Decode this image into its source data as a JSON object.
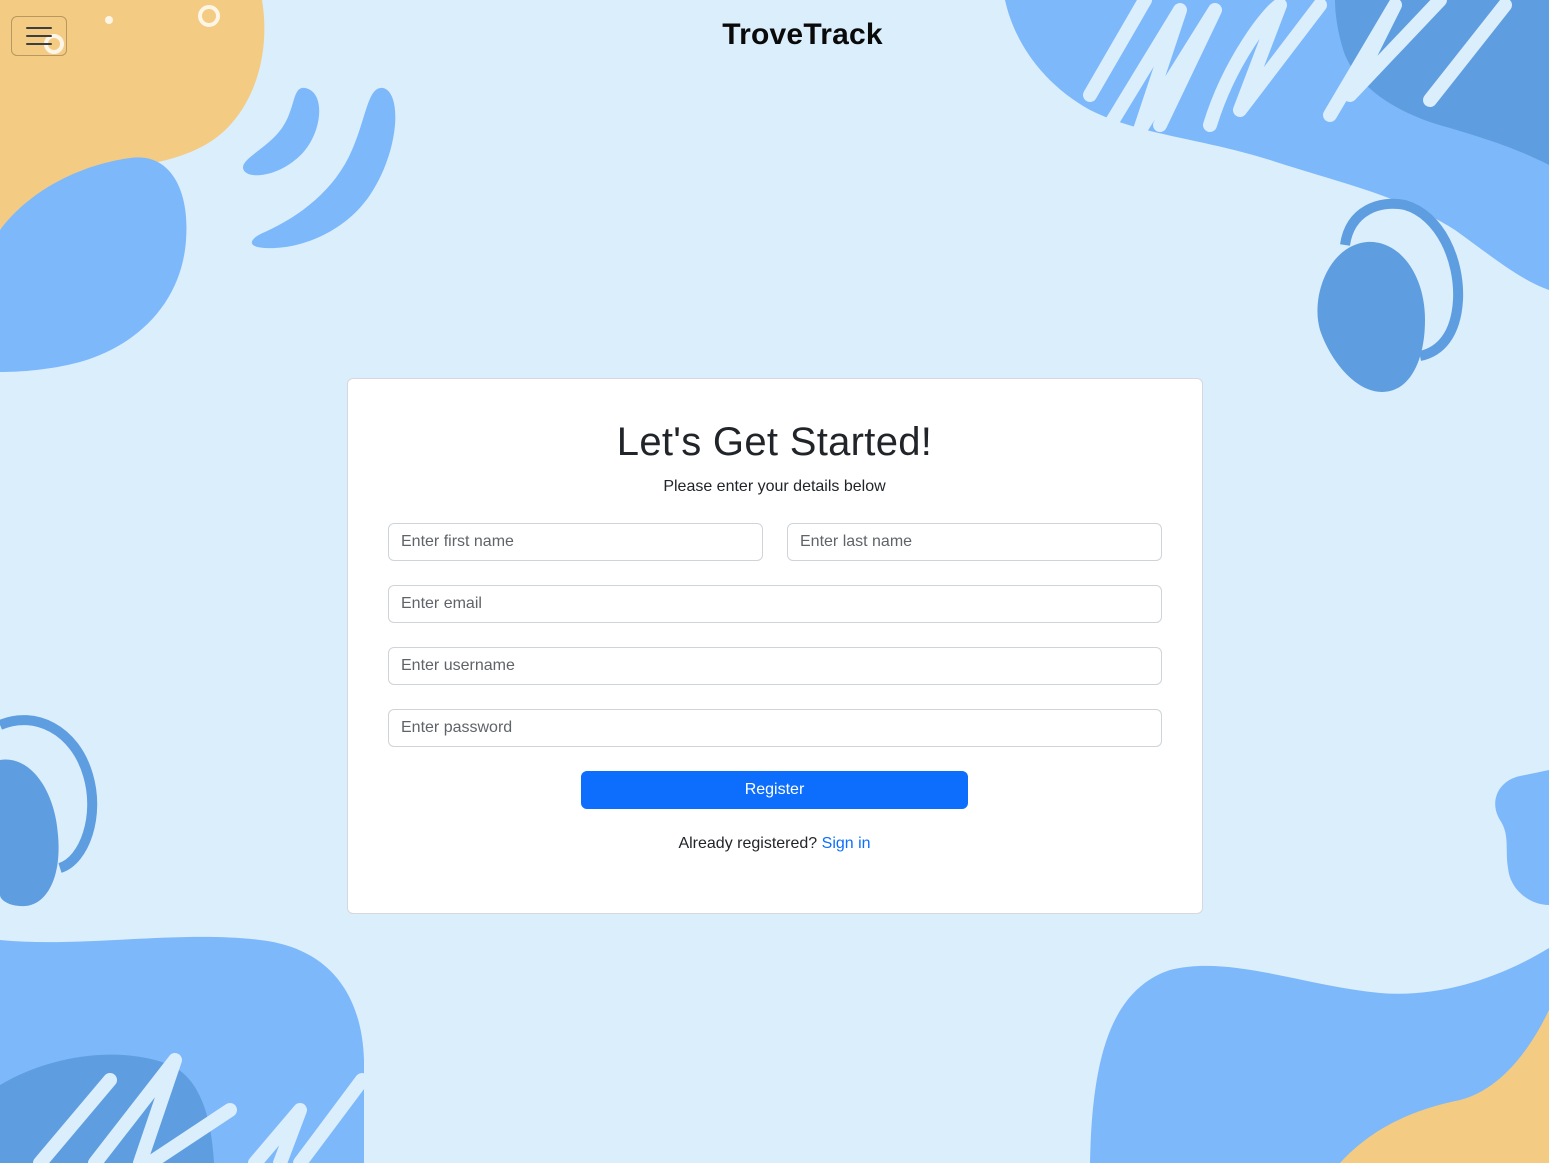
{
  "header": {
    "brand": "TroveTrack",
    "menu_icon": "hamburger-icon"
  },
  "form": {
    "title": "Let's Get Started!",
    "subtitle": "Please enter your details below",
    "first_name_placeholder": "Enter first name",
    "last_name_placeholder": "Enter last name",
    "email_placeholder": "Enter email",
    "username_placeholder": "Enter username",
    "password_placeholder": "Enter password",
    "submit_label": "Register",
    "signin_prompt": "Already registered?",
    "signin_link": "Sign in"
  },
  "colors": {
    "background": "#dbeefc",
    "blob_light_blue": "#7db8fb",
    "blob_mid_blue": "#5e9ee0",
    "blob_orange": "#f4cb83",
    "primary": "#0d6efd"
  }
}
